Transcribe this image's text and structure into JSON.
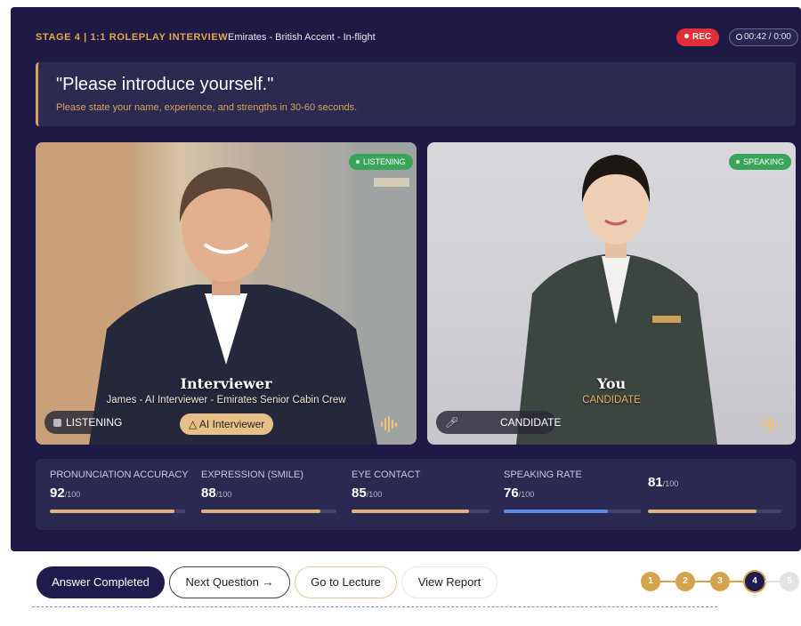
{
  "header": {
    "stage_label": "STAGE 4 | 1:1 ROLEPLAY INTERVIEW",
    "context": "Emirates - British Accent - In-flight",
    "rec_label": "REC",
    "timer": "00:42 / 0:00"
  },
  "question": {
    "text": "\"Please introduce yourself.\"",
    "hint": "Please state your name, experience, and strengths in 30-60 seconds."
  },
  "interviewer_tile": {
    "status": "LISTENING",
    "title": "Interviewer",
    "subtitle": "James - AI Interviewer - Emirates Senior Cabin Crew",
    "status_chip": "LISTENING",
    "role_chip": "AI Interviewer"
  },
  "candidate_tile": {
    "status": "SPEAKING",
    "title": "You",
    "subtitle": "CANDIDATE",
    "role_chip": "CANDIDATE"
  },
  "metrics": [
    {
      "label": "PRONUNCIATION ACCURACY",
      "value": "92",
      "max": "/100",
      "level": 0.92,
      "color": "#e0b07a"
    },
    {
      "label": "EXPRESSION (SMILE)",
      "value": "88",
      "max": "/100",
      "level": 0.88,
      "color": "#e0b07a"
    },
    {
      "label": "EYE CONTACT",
      "value": "85",
      "max": "/100",
      "level": 0.85,
      "color": "#e0b07a"
    },
    {
      "label": "SPEAKING RATE",
      "value": "76",
      "max": "/100",
      "level": 0.76,
      "color": "#5b8be6"
    },
    {
      "label": "",
      "value": "81",
      "max": "/100",
      "level": 0.81,
      "color": "#e0b07a"
    }
  ],
  "actions": {
    "answer_completed": "Answer Completed",
    "next_question": "Next Question →",
    "go_to_lecture": "Go to Lecture",
    "view_report": "View Report"
  },
  "progress": {
    "steps": [
      "1",
      "2",
      "3",
      "4",
      "5"
    ],
    "current": 4
  },
  "colors": {
    "app_bg": "#1e1a45",
    "accent_gold": "#d4a34d",
    "rec_red": "#e02f3a",
    "status_green": "#3aa45a"
  }
}
